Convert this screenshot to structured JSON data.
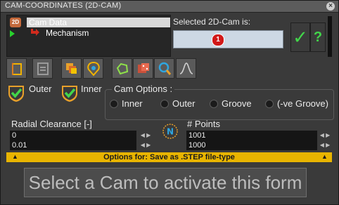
{
  "window": {
    "title": "CAM-COORDINATES (2D-CAM)",
    "close_icon": "×"
  },
  "tree": {
    "icon_text": "2D",
    "items": [
      {
        "label": "Cam Data"
      },
      {
        "label": "Mechanism"
      }
    ]
  },
  "selected": {
    "label": "Selected 2D-Cam is:",
    "badge": "1"
  },
  "actions": {
    "ok_glyph": "✓",
    "help_glyph": "?"
  },
  "toolbar": {
    "icons": [
      "cam-frame-icon",
      "layers-icon",
      "stack-icon",
      "cam-profile-icon",
      "polygon-icon",
      "dice-icon",
      "zoom-icon",
      "curve-icon"
    ]
  },
  "checkboxes": [
    {
      "label": "Outer",
      "checked": true
    },
    {
      "label": "Inner",
      "checked": true
    }
  ],
  "cam_options": {
    "title": "Cam Options :",
    "radios": [
      "Inner",
      "Outer",
      "Groove",
      "(-ve Groove)"
    ]
  },
  "radial_clearance": {
    "label": "Radial Clearance [-]",
    "line1": "0",
    "line2": "0.01"
  },
  "points": {
    "label": "# Points",
    "line1": "1001",
    "line2": "1000"
  },
  "n_icon_text": "N",
  "options_bar": {
    "text": "Options for: Save as .STEP file-type"
  },
  "message": {
    "text": "Select a Cam to activate this form"
  },
  "colors": {
    "accent_green": "#42d64a",
    "warning_bar": "#e8b400",
    "badge_red": "#d11818"
  }
}
